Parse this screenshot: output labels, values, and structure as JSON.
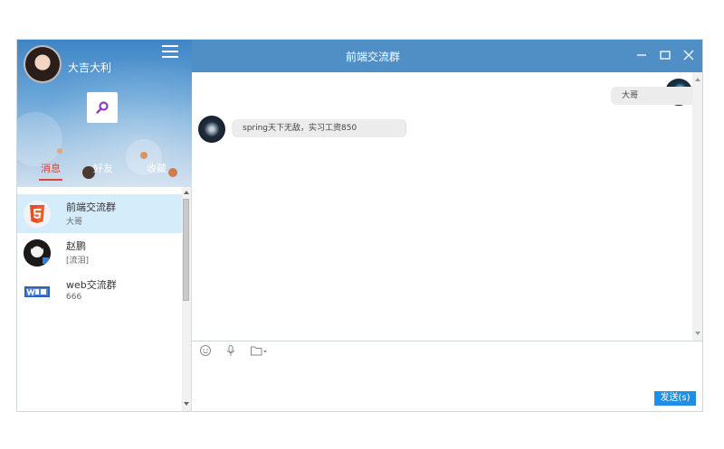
{
  "user": {
    "name": "大吉大利"
  },
  "tabs": [
    {
      "label": "消息",
      "active": true
    },
    {
      "label": "好友",
      "active": false
    },
    {
      "label": "收藏",
      "active": false
    }
  ],
  "conversations": [
    {
      "name": "前端交流群",
      "preview": "大哥",
      "avatar_icon": "html5-icon",
      "active": true
    },
    {
      "name": "赵鹏",
      "preview": "[流泪]",
      "avatar_icon": "user-avatar-icon",
      "active": false
    },
    {
      "name": "web交流群",
      "preview": "666",
      "avatar_icon": "web-logo-icon",
      "active": false
    }
  ],
  "chat": {
    "title": "前端交流群",
    "messages": [
      {
        "side": "right",
        "text": "大哥"
      },
      {
        "side": "left",
        "text": "spring天下无敌，实习工资850"
      }
    ]
  },
  "toolbar": {
    "emoji_icon": "emoji-icon",
    "mic_icon": "microphone-icon",
    "folder_icon": "folder-icon"
  },
  "send_label": "发送(s)",
  "colors": {
    "titlebar": "#4f8fc6",
    "accent": "#e0423a",
    "send_button": "#1e8fe6",
    "active_item": "#d5ecfb"
  }
}
